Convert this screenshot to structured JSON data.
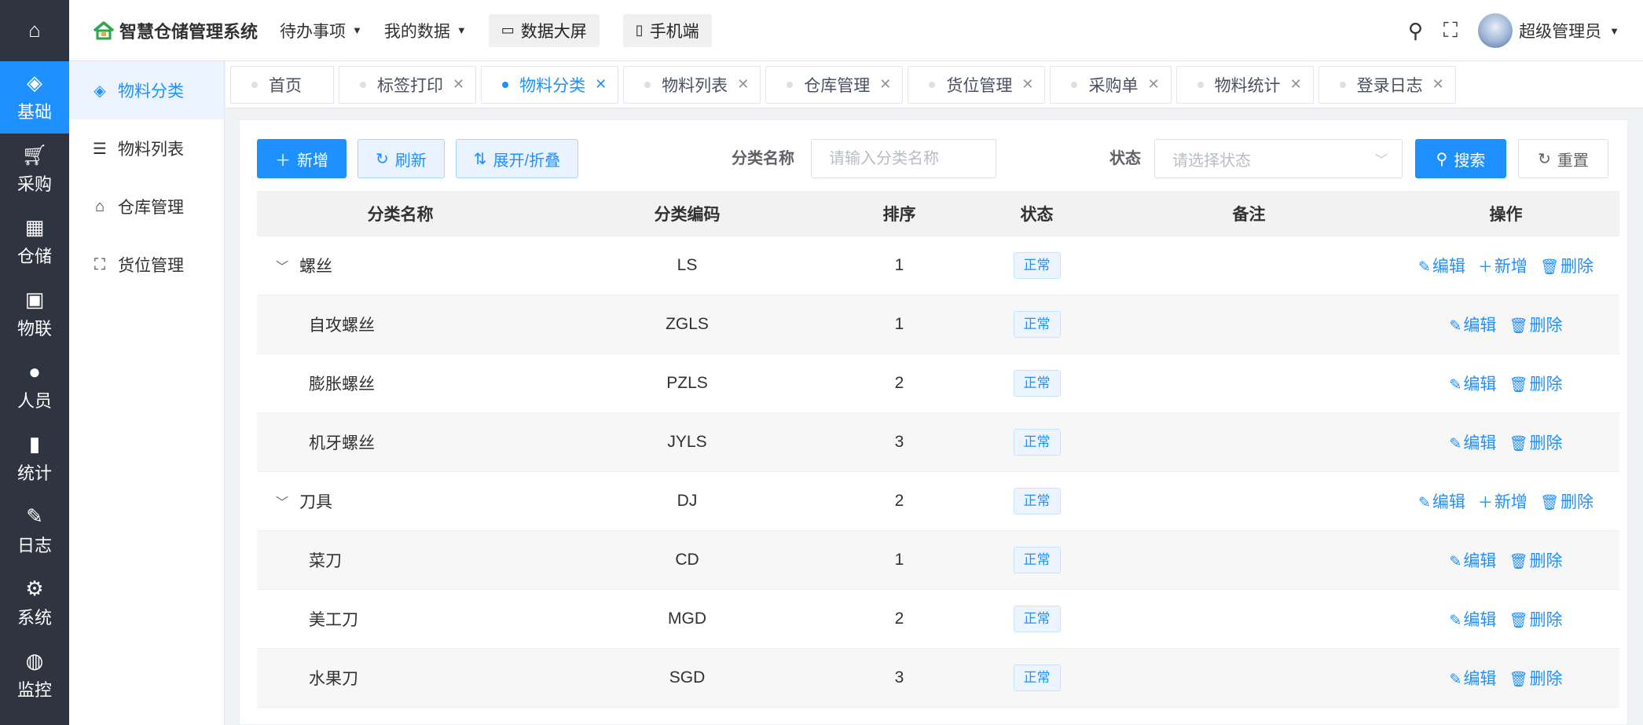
{
  "app": {
    "title": "智慧仓储管理系统",
    "brand_color": "#1e90ff",
    "logo_color": "#2aa84a"
  },
  "rail": {
    "home_icon": "home-icon",
    "items": [
      {
        "label": "基础",
        "icon": "grid-icon",
        "active": true
      },
      {
        "label": "采购",
        "icon": "cart-icon"
      },
      {
        "label": "仓储",
        "icon": "table-icon"
      },
      {
        "label": "物联",
        "icon": "iot-icon"
      },
      {
        "label": "人员",
        "icon": "users-icon"
      },
      {
        "label": "统计",
        "icon": "bar-chart-icon"
      },
      {
        "label": "日志",
        "icon": "edit-log-icon"
      },
      {
        "label": "系统",
        "icon": "gear-icon"
      },
      {
        "label": "监控",
        "icon": "globe-icon"
      }
    ]
  },
  "header": {
    "menu_todo": "待办事项",
    "menu_mydata": "我的数据",
    "btn_bigscreen": "数据大屏",
    "btn_mobile": "手机端",
    "user_name": "超级管理员"
  },
  "subnav": {
    "items": [
      {
        "label": "物料分类",
        "icon": "category-icon",
        "active": true
      },
      {
        "label": "物料列表",
        "icon": "list-icon"
      },
      {
        "label": "仓库管理",
        "icon": "warehouse-icon"
      },
      {
        "label": "货位管理",
        "icon": "location-icon"
      }
    ]
  },
  "tabs": [
    {
      "label": "首页",
      "closable": false
    },
    {
      "label": "标签打印",
      "closable": true
    },
    {
      "label": "物料分类",
      "closable": true,
      "active": true
    },
    {
      "label": "物料列表",
      "closable": true
    },
    {
      "label": "仓库管理",
      "closable": true
    },
    {
      "label": "货位管理",
      "closable": true
    },
    {
      "label": "采购单",
      "closable": true
    },
    {
      "label": "物料统计",
      "closable": true
    },
    {
      "label": "登录日志",
      "closable": true
    }
  ],
  "toolbar": {
    "add": "新增",
    "refresh": "刷新",
    "expand": "展开/折叠",
    "name_label": "分类名称",
    "name_placeholder": "请输入分类名称",
    "status_label": "状态",
    "status_placeholder": "请选择状态",
    "search": "搜索",
    "reset": "重置"
  },
  "table": {
    "columns": [
      "分类名称",
      "分类编码",
      "排序",
      "状态",
      "备注",
      "操作"
    ],
    "ops": {
      "edit": "编辑",
      "add": "新增",
      "delete": "删除"
    },
    "rows": [
      {
        "name": "螺丝",
        "code": "LS",
        "sort": "1",
        "status": "正常",
        "remark": "",
        "level": 0
      },
      {
        "name": "自攻螺丝",
        "code": "ZGLS",
        "sort": "1",
        "status": "正常",
        "remark": "",
        "level": 1
      },
      {
        "name": "膨胀螺丝",
        "code": "PZLS",
        "sort": "2",
        "status": "正常",
        "remark": "",
        "level": 1
      },
      {
        "name": "机牙螺丝",
        "code": "JYLS",
        "sort": "3",
        "status": "正常",
        "remark": "",
        "level": 1
      },
      {
        "name": "刀具",
        "code": "DJ",
        "sort": "2",
        "status": "正常",
        "remark": "",
        "level": 0
      },
      {
        "name": "菜刀",
        "code": "CD",
        "sort": "1",
        "status": "正常",
        "remark": "",
        "level": 1
      },
      {
        "name": "美工刀",
        "code": "MGD",
        "sort": "2",
        "status": "正常",
        "remark": "",
        "level": 1
      },
      {
        "name": "水果刀",
        "code": "SGD",
        "sort": "3",
        "status": "正常",
        "remark": "",
        "level": 1
      }
    ]
  }
}
